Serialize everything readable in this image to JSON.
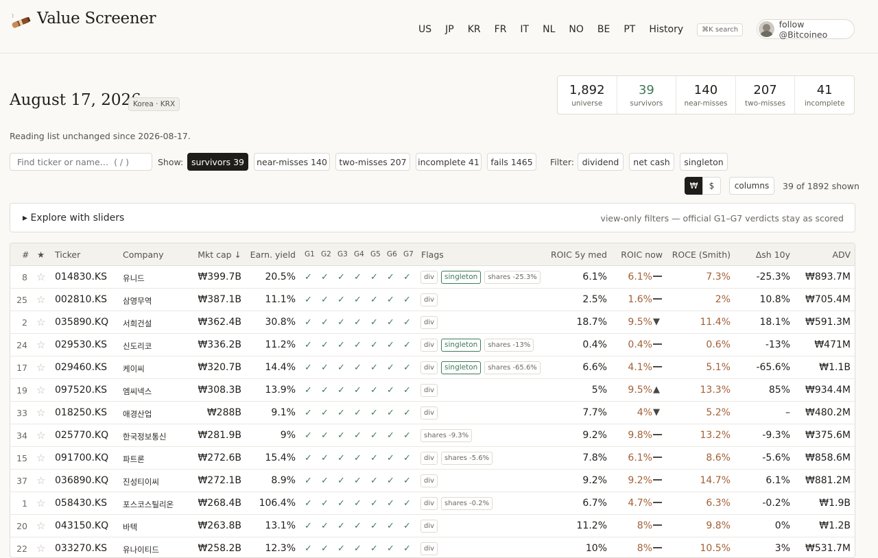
{
  "header": {
    "brand": "Value Screener",
    "nav": [
      "US",
      "JP",
      "KR",
      "FR",
      "IT",
      "NL",
      "NO",
      "BE",
      "PT",
      "History"
    ],
    "search_hint": "⌘K search",
    "follow_label": "follow @Bitcoineo"
  },
  "summary": {
    "date": "August 17, 2026",
    "market": "Korea · KRX",
    "reading_note": "Reading list unchanged since 2026-08-17.",
    "stats": [
      {
        "value": "1,892",
        "label": "universe"
      },
      {
        "value": "39",
        "label": "survivors"
      },
      {
        "value": "140",
        "label": "near-misses"
      },
      {
        "value": "207",
        "label": "two-misses"
      },
      {
        "value": "41",
        "label": "incomplete"
      }
    ]
  },
  "controls": {
    "search_placeholder": "Find ticker or name…  ( / )",
    "show_label": "Show:",
    "show_chips": [
      "survivors 39",
      "near-misses 140",
      "two-misses 207",
      "incomplete 41",
      "fails 1465"
    ],
    "active_show": "survivors 39",
    "filter_label": "Filter:",
    "filter_chips": [
      "dividend",
      "net cash",
      "singleton"
    ],
    "currency_options": [
      "₩",
      "$"
    ],
    "active_currency": "₩",
    "columns_label": "columns",
    "shown_count": "39 of 1892 shown"
  },
  "explore": {
    "title": "▸ Explore with sliders",
    "note": "view-only filters — official G1–G7 verdicts stay as scored"
  },
  "table": {
    "headers": {
      "rank": "#",
      "star": "★",
      "ticker": "Ticker",
      "company": "Company",
      "mktcap": "Mkt cap ↓",
      "ey": "Earn. yield",
      "gates": [
        "G1",
        "G2",
        "G3",
        "G4",
        "G5",
        "G6",
        "G7"
      ],
      "flags": "Flags",
      "roic5": "ROIC 5y med",
      "roicnow": "ROIC now",
      "roce": "ROCE (Smith)",
      "dsh": "Δsh 10y",
      "adv": "ADV"
    },
    "check_glyph": "✓",
    "star_glyph": "☆",
    "rows": [
      {
        "rank": "8",
        "ticker": "014830.KS",
        "company": "유니드",
        "mktcap": "₩399.7B",
        "ey": "20.5%",
        "flags": [
          "div",
          "singleton",
          "shares -25.3%"
        ],
        "roic5": "6.1%",
        "roicnow": "6.1%",
        "trend": "flat",
        "roce": "7.3%",
        "dsh": "-25.3%",
        "adv": "₩893.7M"
      },
      {
        "rank": "25",
        "ticker": "002810.KS",
        "company": "삼영무역",
        "mktcap": "₩387.1B",
        "ey": "11.1%",
        "flags": [
          "div"
        ],
        "roic5": "2.5%",
        "roicnow": "1.6%",
        "trend": "flat",
        "roce": "2%",
        "dsh": "10.8%",
        "adv": "₩705.4M"
      },
      {
        "rank": "2",
        "ticker": "035890.KQ",
        "company": "서희건설",
        "mktcap": "₩362.4B",
        "ey": "30.8%",
        "flags": [
          "div"
        ],
        "roic5": "18.7%",
        "roicnow": "9.5%",
        "trend": "down",
        "roce": "11.4%",
        "dsh": "18.1%",
        "adv": "₩591.3M"
      },
      {
        "rank": "24",
        "ticker": "029530.KS",
        "company": "신도리코",
        "mktcap": "₩336.2B",
        "ey": "11.2%",
        "flags": [
          "div",
          "singleton",
          "shares -13%"
        ],
        "roic5": "0.4%",
        "roicnow": "0.4%",
        "trend": "flat",
        "roce": "0.6%",
        "dsh": "-13%",
        "adv": "₩471M"
      },
      {
        "rank": "17",
        "ticker": "029460.KS",
        "company": "케이씨",
        "mktcap": "₩320.7B",
        "ey": "14.4%",
        "flags": [
          "div",
          "singleton",
          "shares -65.6%"
        ],
        "roic5": "6.6%",
        "roicnow": "4.1%",
        "trend": "flat",
        "roce": "5.1%",
        "dsh": "-65.6%",
        "adv": "₩1.1B"
      },
      {
        "rank": "19",
        "ticker": "097520.KS",
        "company": "엠씨넥스",
        "mktcap": "₩308.3B",
        "ey": "13.9%",
        "flags": [
          "div"
        ],
        "roic5": "5%",
        "roicnow": "9.5%",
        "trend": "up",
        "roce": "13.3%",
        "dsh": "85%",
        "adv": "₩934.4M"
      },
      {
        "rank": "33",
        "ticker": "018250.KS",
        "company": "애경산업",
        "mktcap": "₩288B",
        "ey": "9.1%",
        "flags": [
          "div"
        ],
        "roic5": "7.7%",
        "roicnow": "4%",
        "trend": "down",
        "roce": "5.2%",
        "dsh": "–",
        "adv": "₩480.2M"
      },
      {
        "rank": "34",
        "ticker": "025770.KQ",
        "company": "한국정보통신",
        "mktcap": "₩281.9B",
        "ey": "9%",
        "flags": [
          "shares -9.3%"
        ],
        "roic5": "9.2%",
        "roicnow": "9.8%",
        "trend": "flat",
        "roce": "13.2%",
        "dsh": "-9.3%",
        "adv": "₩375.6M"
      },
      {
        "rank": "15",
        "ticker": "091700.KQ",
        "company": "파트론",
        "mktcap": "₩272.6B",
        "ey": "15.4%",
        "flags": [
          "div",
          "shares -5.6%"
        ],
        "roic5": "7.8%",
        "roicnow": "6.1%",
        "trend": "flat",
        "roce": "8.6%",
        "dsh": "-5.6%",
        "adv": "₩858.6M"
      },
      {
        "rank": "37",
        "ticker": "036890.KQ",
        "company": "진성티이씨",
        "mktcap": "₩272.1B",
        "ey": "8.9%",
        "flags": [
          "div"
        ],
        "roic5": "9.2%",
        "roicnow": "9.2%",
        "trend": "flat",
        "roce": "14.7%",
        "dsh": "6.1%",
        "adv": "₩881.2M"
      },
      {
        "rank": "1",
        "ticker": "058430.KS",
        "company": "포스코스틸리온",
        "mktcap": "₩268.4B",
        "ey": "106.4%",
        "flags": [
          "div",
          "shares -0.2%"
        ],
        "roic5": "6.7%",
        "roicnow": "4.7%",
        "trend": "flat",
        "roce": "6.3%",
        "dsh": "-0.2%",
        "adv": "₩1.9B"
      },
      {
        "rank": "20",
        "ticker": "043150.KQ",
        "company": "바텍",
        "mktcap": "₩263.8B",
        "ey": "13.1%",
        "flags": [
          "div"
        ],
        "roic5": "11.2%",
        "roicnow": "8%",
        "trend": "flat",
        "roce": "9.8%",
        "dsh": "0%",
        "adv": "₩1.2B"
      },
      {
        "rank": "22",
        "ticker": "033270.KS",
        "company": "유나이티드",
        "mktcap": "₩258.2B",
        "ey": "12.3%",
        "flags": [
          "div"
        ],
        "roic5": "10%",
        "roicnow": "8%",
        "trend": "flat",
        "roce": "10.5%",
        "dsh": "3%",
        "adv": "₩531.7M"
      }
    ]
  }
}
